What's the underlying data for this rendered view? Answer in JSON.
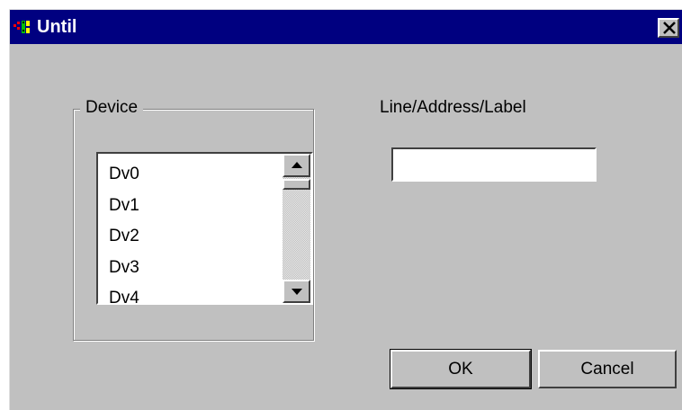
{
  "window": {
    "title": "Until"
  },
  "device_group": {
    "label": "Device",
    "items": [
      "Dv0",
      "Dv1",
      "Dv2",
      "Dv3",
      "Dv4"
    ]
  },
  "address_field": {
    "label": "Line/Address/Label",
    "value": ""
  },
  "buttons": {
    "ok_label": "OK",
    "cancel_label": "Cancel"
  },
  "colors": {
    "titlebar": "#000080",
    "face": "#c0c0c0"
  },
  "icons": {
    "app": "app-icon",
    "close": "close-icon",
    "scroll_up": "scroll-up-arrow-icon",
    "scroll_down": "scroll-down-arrow-icon"
  }
}
